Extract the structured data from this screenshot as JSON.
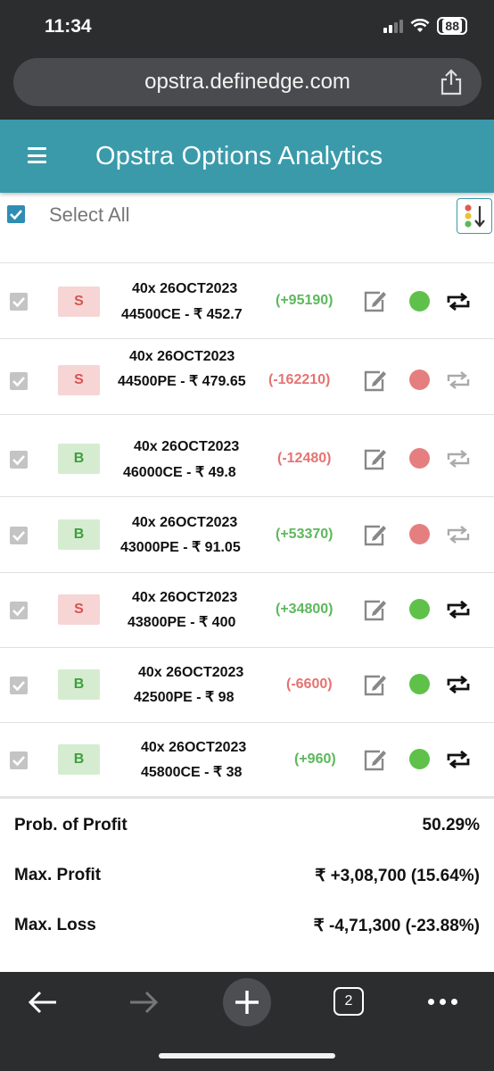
{
  "status_bar": {
    "time": "11:34",
    "battery": "88"
  },
  "browser": {
    "url": "opstra.definedge.com",
    "tab_count": "2"
  },
  "app": {
    "title": "Opstra Options Analytics"
  },
  "select_all": {
    "label": "Select All",
    "checked": true
  },
  "legs": [
    {
      "side": "S",
      "line1": "40x  26OCT2023",
      "line2": "44500CE  - ₹ 452.7",
      "pnl": "(+95190)",
      "pnl_sign": "pos",
      "status": "on"
    },
    {
      "side": "S",
      "line1": "40x  26OCT2023",
      "line2": "44500PE  - ₹ 479.65",
      "pnl": "(-162210)",
      "pnl_sign": "neg",
      "status": "off"
    },
    {
      "side": "B",
      "line1": "40x  26OCT2023",
      "line2": "46000CE  - ₹ 49.8",
      "pnl": "(-12480)",
      "pnl_sign": "neg",
      "status": "off"
    },
    {
      "side": "B",
      "line1": "40x  26OCT2023",
      "line2": "43000PE  - ₹ 91.05",
      "pnl": "(+53370)",
      "pnl_sign": "pos",
      "status": "off"
    },
    {
      "side": "S",
      "line1": "40x  26OCT2023",
      "line2": "43800PE  - ₹ 400",
      "pnl": "(+34800)",
      "pnl_sign": "pos",
      "status": "on"
    },
    {
      "side": "B",
      "line1": "40x  26OCT2023",
      "line2": "42500PE  - ₹ 98",
      "pnl": "(-6600)",
      "pnl_sign": "neg",
      "status": "on"
    },
    {
      "side": "B",
      "line1": "40x  26OCT2023",
      "line2": "45800CE  - ₹ 38",
      "pnl": "(+960)",
      "pnl_sign": "pos",
      "status": "on"
    }
  ],
  "summary": [
    {
      "label": "Prob. of Profit",
      "value": "50.29%"
    },
    {
      "label": "Max. Profit",
      "value": "₹ +3,08,700 (15.64%)"
    },
    {
      "label": "Max. Loss",
      "value": "₹ -4,71,300 (-23.88%)"
    }
  ],
  "colors": {
    "header": "#3a9aaa",
    "profit": "#5cb85c",
    "loss": "#e57373"
  }
}
